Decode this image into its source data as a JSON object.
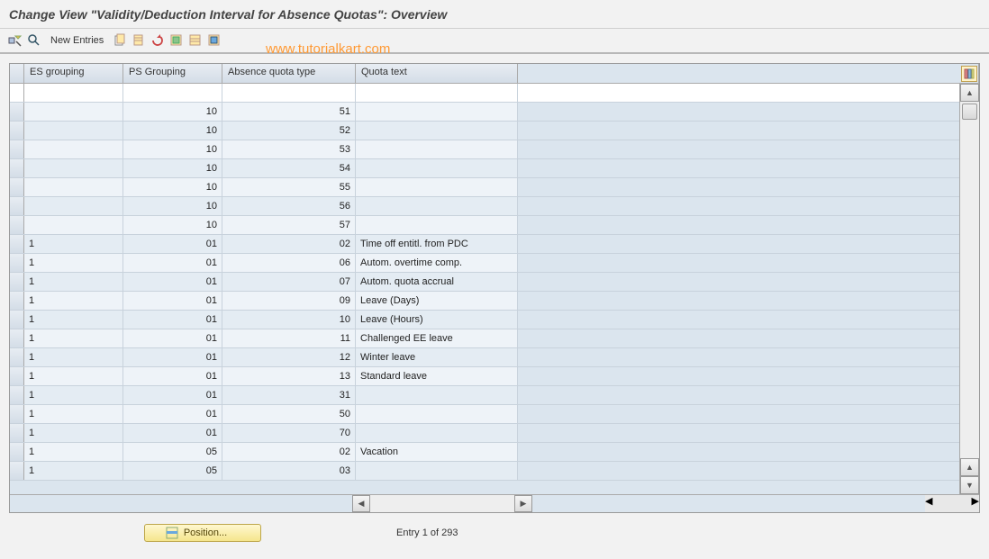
{
  "title": "Change View \"Validity/Deduction Interval for Absence Quotas\": Overview",
  "watermark": "www.tutorialkart.com",
  "toolbar": {
    "new_entries_label": "New Entries"
  },
  "table": {
    "columns": {
      "es_grouping": "ES grouping",
      "ps_grouping": "PS Grouping",
      "absence_quota_type": "Absence quota type",
      "quota_text": "Quota text"
    },
    "rows": [
      {
        "es": "",
        "ps": "10",
        "aqt": "51",
        "qt": ""
      },
      {
        "es": "",
        "ps": "10",
        "aqt": "52",
        "qt": ""
      },
      {
        "es": "",
        "ps": "10",
        "aqt": "53",
        "qt": ""
      },
      {
        "es": "",
        "ps": "10",
        "aqt": "54",
        "qt": ""
      },
      {
        "es": "",
        "ps": "10",
        "aqt": "55",
        "qt": ""
      },
      {
        "es": "",
        "ps": "10",
        "aqt": "56",
        "qt": ""
      },
      {
        "es": "",
        "ps": "10",
        "aqt": "57",
        "qt": ""
      },
      {
        "es": "1",
        "ps": "01",
        "aqt": "02",
        "qt": "Time off entitl. from PDC"
      },
      {
        "es": "1",
        "ps": "01",
        "aqt": "06",
        "qt": "Autom. overtime comp."
      },
      {
        "es": "1",
        "ps": "01",
        "aqt": "07",
        "qt": "Autom. quota accrual"
      },
      {
        "es": "1",
        "ps": "01",
        "aqt": "09",
        "qt": "Leave (Days)"
      },
      {
        "es": "1",
        "ps": "01",
        "aqt": "10",
        "qt": "Leave (Hours)"
      },
      {
        "es": "1",
        "ps": "01",
        "aqt": "11",
        "qt": "Challenged EE leave"
      },
      {
        "es": "1",
        "ps": "01",
        "aqt": "12",
        "qt": "Winter leave"
      },
      {
        "es": "1",
        "ps": "01",
        "aqt": "13",
        "qt": "Standard leave"
      },
      {
        "es": "1",
        "ps": "01",
        "aqt": "31",
        "qt": ""
      },
      {
        "es": "1",
        "ps": "01",
        "aqt": "50",
        "qt": ""
      },
      {
        "es": "1",
        "ps": "01",
        "aqt": "70",
        "qt": ""
      },
      {
        "es": "1",
        "ps": "05",
        "aqt": "02",
        "qt": "Vacation"
      },
      {
        "es": "1",
        "ps": "05",
        "aqt": "03",
        "qt": ""
      }
    ]
  },
  "footer": {
    "position_label": "Position...",
    "entry_text": "Entry 1 of 293"
  },
  "colors": {
    "accent_orange": "#ff9933",
    "header_bg": "#dbe5ee"
  }
}
